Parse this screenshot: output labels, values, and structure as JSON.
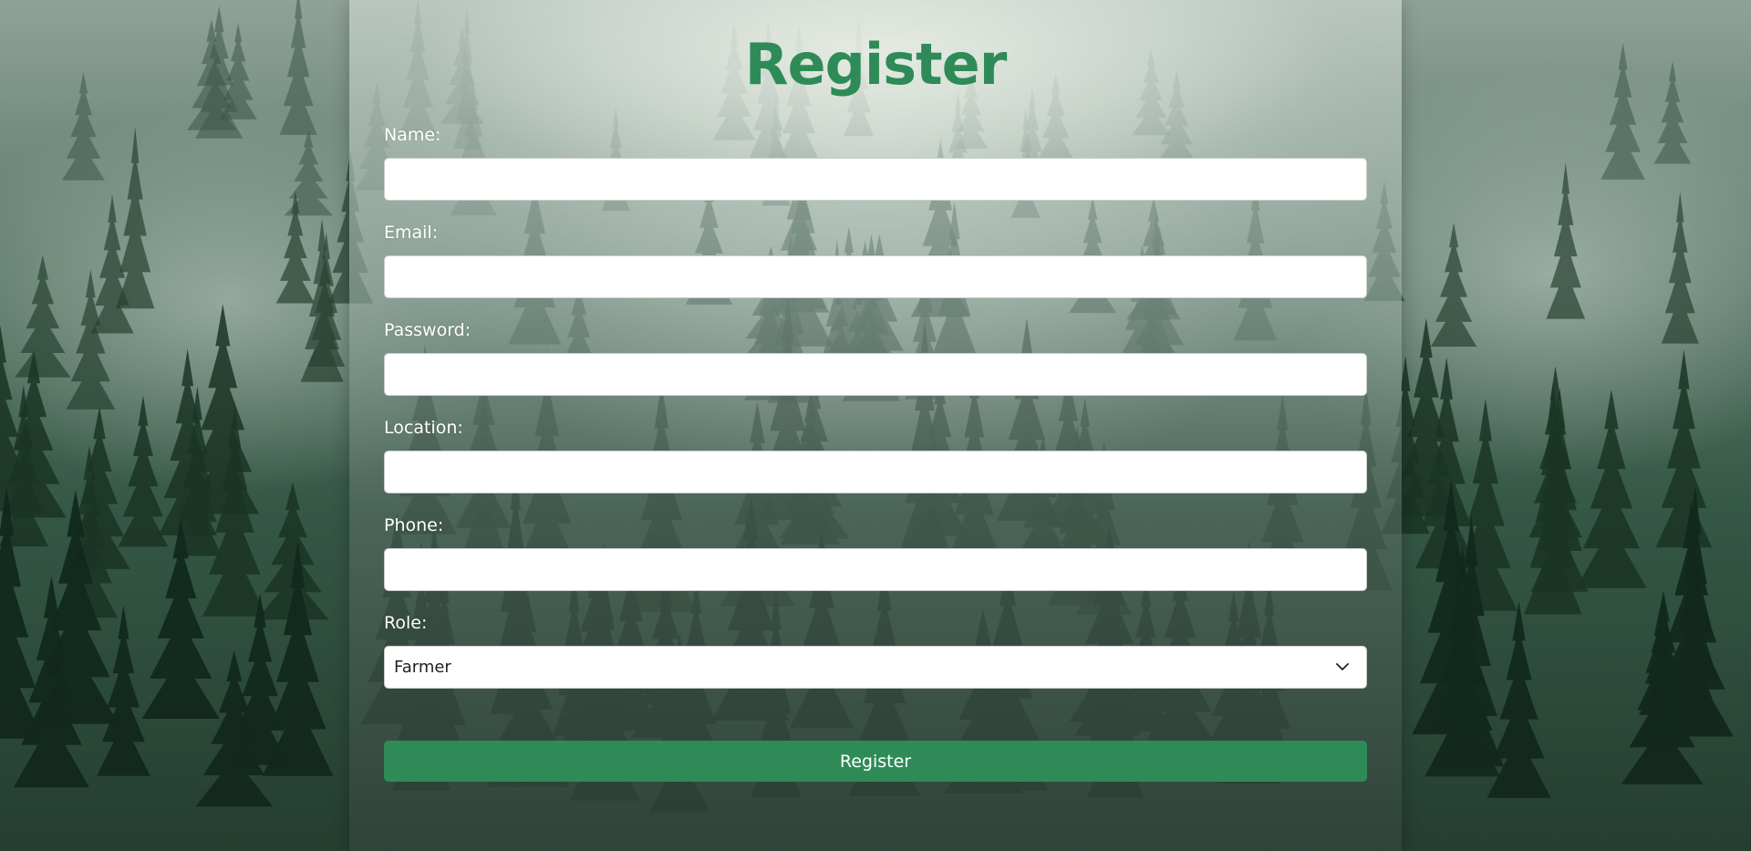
{
  "page": {
    "title": "Register",
    "background": "misty-forest-image",
    "accent_color": "#2e8b57"
  },
  "form": {
    "fields": [
      {
        "label": "Name:",
        "value": "",
        "placeholder": ""
      },
      {
        "label": "Email:",
        "value": "",
        "placeholder": ""
      },
      {
        "label": "Password:",
        "value": "",
        "placeholder": ""
      },
      {
        "label": "Location:",
        "value": "",
        "placeholder": ""
      },
      {
        "label": "Phone:",
        "value": "",
        "placeholder": ""
      }
    ],
    "role": {
      "label": "Role:",
      "selected": "Farmer",
      "icon": "chevron-down-icon"
    },
    "submit_label": "Register"
  }
}
